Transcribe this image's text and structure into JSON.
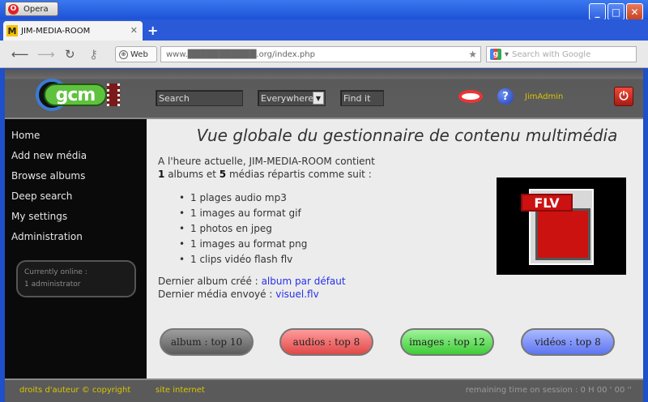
{
  "browser": {
    "app_button": "Opera",
    "tab_title": "JIM-MEDIA-ROOM",
    "tab_icon": "M",
    "web_badge": "Web",
    "url": "www.███████████.org/index.php",
    "search_placeholder": "Search with Google"
  },
  "header": {
    "logo_text": "gcm",
    "search_placeholder": "Search",
    "scope_value": "Everywhere",
    "find_button": "Find it",
    "help_glyph": "?",
    "username": "JimAdmin"
  },
  "sidebar": {
    "items": [
      {
        "label": "Home"
      },
      {
        "label": "Add new média"
      },
      {
        "label": "Browse albums"
      },
      {
        "label": "Deep search"
      },
      {
        "label": "My settings"
      },
      {
        "label": "Administration"
      }
    ],
    "online_title": "Currently online :",
    "online_value": "1 administrator"
  },
  "main": {
    "title": "Vue globale du gestionnaire de contenu multimédia",
    "intro_line1": "A l'heure actuelle, JIM-MEDIA-ROOM contient",
    "albums_count": "1",
    "albums_text": "albums et",
    "medias_count": "5",
    "medias_text": "médias répartis comme suit :",
    "media_list": [
      "1 plages audio mp3",
      "1 images au format gif",
      "1 photos en jpeg",
      "1 images au format png",
      "1 clips vidéo flash flv"
    ],
    "last_album_label": "Dernier album créé :",
    "last_album_link": "album par défaut",
    "last_media_label": "Dernier média envoyé :",
    "last_media_link": "visuel.flv",
    "thumbnail_label": "FLV",
    "buttons": {
      "albums": "album : top 10",
      "audios": "audios : top 8",
      "images": "images : top 12",
      "videos": "vidéos : top 8"
    }
  },
  "footer": {
    "copyright": "droits d'auteur © copyright",
    "site": "site internet",
    "remaining": "remaining time on session : 0 H 00 ' 00 ''"
  },
  "colors": {
    "accent_yellow": "#d8c400",
    "link_blue": "#2730e8"
  }
}
